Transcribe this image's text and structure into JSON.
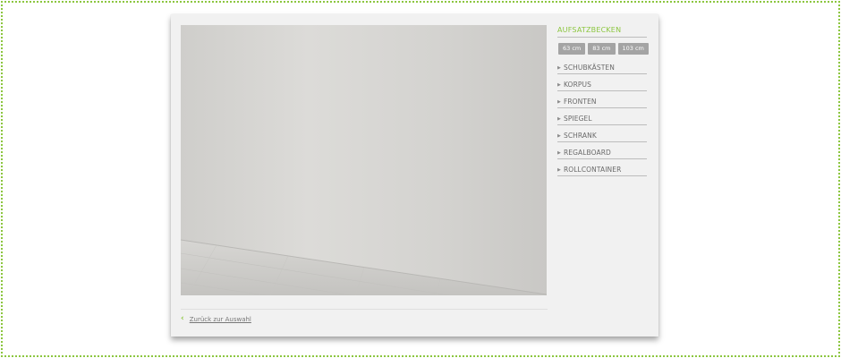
{
  "colors": {
    "accent": "#8cc63f",
    "panel_background": "#f1f1f1",
    "size_button": "#a4a4a4",
    "preview_wall": "#d6d5d2",
    "preview_floor": "#cfcecb"
  },
  "preview": {
    "image": "bathroom-wall-floor-render"
  },
  "sidebar": {
    "heading": "AUFSATZBECKEN",
    "sizes": [
      {
        "label": "63 cm"
      },
      {
        "label": "83 cm"
      },
      {
        "label": "103 cm"
      }
    ],
    "menu": [
      {
        "label": "SCHUBKÄSTEN",
        "icon": "caret-right-icon"
      },
      {
        "label": "KORPUS",
        "icon": "caret-right-icon"
      },
      {
        "label": "FRONTEN",
        "icon": "caret-right-icon"
      },
      {
        "label": "SPIEGEL",
        "icon": "caret-right-icon"
      },
      {
        "label": "SCHRANK",
        "icon": "caret-right-icon"
      },
      {
        "label": "REGALBOARD",
        "icon": "caret-right-icon"
      },
      {
        "label": "ROLLCONTAINER",
        "icon": "caret-right-icon"
      }
    ]
  },
  "footer": {
    "back_icon": "chevron-left-icon",
    "back_label": "Zurück zur Auswahl"
  }
}
